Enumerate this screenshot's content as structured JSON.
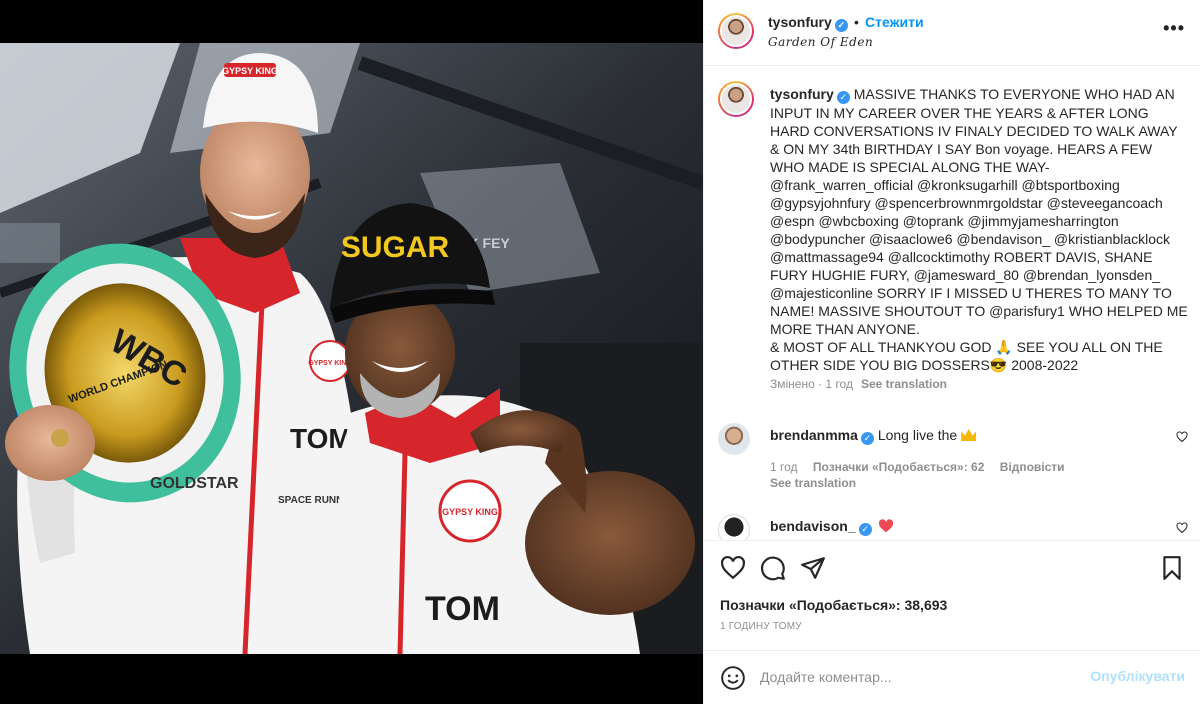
{
  "header": {
    "username": "tysonfury",
    "separator": "•",
    "follow_label": "Стежити",
    "location": "Garden Of Eden",
    "more_label": "•••"
  },
  "photo": {
    "cap1_text": "GYPSY KING",
    "cap2_text": "SUGAR",
    "belt_text1": "WBC",
    "belt_text2": "WORLD CHAMPION",
    "badge_text": "GYPSY KING",
    "sponsor1": "TOM",
    "sponsor2": "GOLDSTAR",
    "sponsor3": "SPACE RUNNER",
    "bg_text": "PARK FEY"
  },
  "caption": {
    "username": "tysonfury",
    "text": "MASSIVE THANKS TO EVERYONE WHO HAD AN INPUT IN MY CAREER OVER THE YEARS & AFTER LONG HARD CONVERSATIONS IV FINALY DECIDED TO WALK AWAY & ON MY 34th BIRTHDAY I SAY Bon voyage. HEARS A FEW WHO MADE IS SPECIAL ALONG THE WAY-@frank_warren_official @kronksugarhill @btsportboxing @gypsyjohnfury @spencerbrownmrgoldstar @steveegancoach @espn @wbcboxing @toprank @jimmyjamesharrington @bodypuncher @isaaclowe6 @bendavison_ @kristianblacklock @mattmassage94 @allcocktimothy ROBERT DAVIS, SHANE FURY HUGHIE FURY, @jamesward_80 @brendan_lyonsden_ @majesticonline SORRY IF I MISSED U THERES TO MANY TO NAME! MASSIVE SHOUTOUT TO @parisfury1 WHO HELPED ME MORE THAN ANYONE.\n& MOST OF ALL THANKYOU GOD 🙏 SEE YOU ALL ON THE OTHER SIDE YOU BIG DOSSERS😎 2008-2022",
    "edited": "Змінено · 1 год",
    "see_translation": "See translation"
  },
  "comments": [
    {
      "username": "brendanmma",
      "text": "Long live the",
      "time": "1 год",
      "likes": "Позначки «Подобається»: 62",
      "reply": "Відповісти",
      "see_translation": "See translation"
    },
    {
      "username": "bendavison_",
      "text": ""
    }
  ],
  "actions": {
    "likes": "Позначки «Подобається»: 38,693",
    "time": "1 ГОДИНУ ТОМУ"
  },
  "add_comment": {
    "placeholder": "Додайте коментар...",
    "publish_label": "Опублікувати"
  },
  "colors": {
    "accent_blue": "#0095f6",
    "publish_disabled": "#b2dffc",
    "verified": "#3897f0",
    "heart_red": "#ed4956"
  }
}
